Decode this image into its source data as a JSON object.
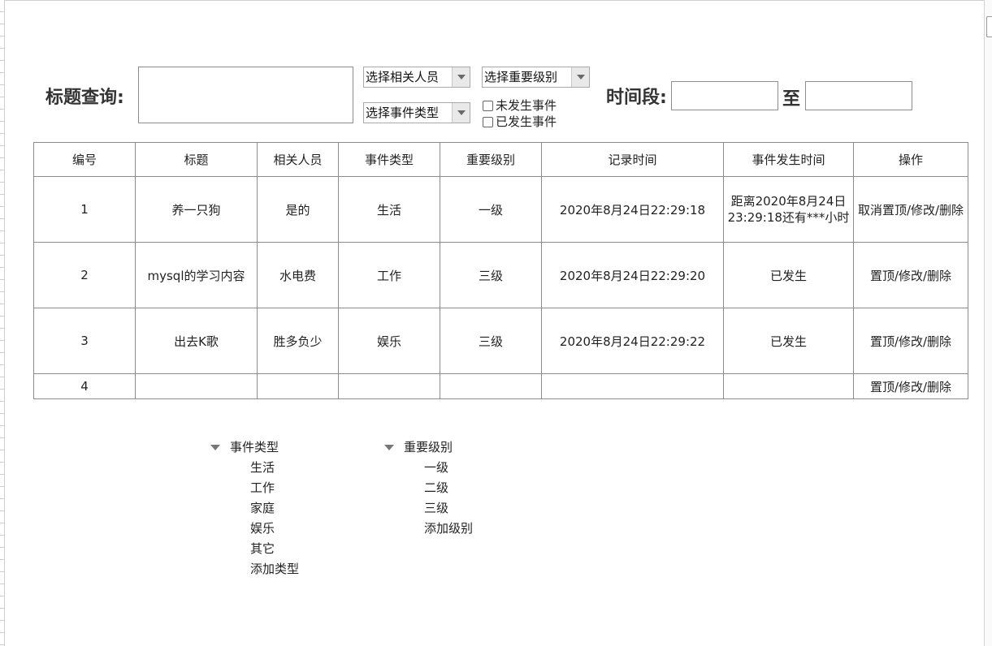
{
  "search": {
    "title_label": "标题查询:",
    "title_value": "",
    "person_select": "选择相关人员",
    "level_select": "选择重要级别",
    "type_select": "选择事件类型",
    "checkbox_not_happened": "未发生事件",
    "checkbox_happened": "已发生事件",
    "time_label": "时间段:",
    "to_label": "至",
    "time_start": "",
    "time_end": ""
  },
  "table": {
    "headers": [
      "编号",
      "标题",
      "相关人员",
      "事件类型",
      "重要级别",
      "记录时间",
      "事件发生时间",
      "操作"
    ],
    "rows": [
      {
        "id": "1",
        "title": "养一只狗",
        "person": "是的",
        "type": "生活",
        "level": "一级",
        "record_time": "2020年8月24日22:29:18",
        "event_time": "距离2020年8月24日23:29:18还有***小时",
        "action": "取消置顶/修改/删除"
      },
      {
        "id": "2",
        "title": "mysql的学习内容",
        "person": "水电费",
        "type": "工作",
        "level": "三级",
        "record_time": "2020年8月24日22:29:20",
        "event_time": "已发生",
        "action": "置顶/修改/删除"
      },
      {
        "id": "3",
        "title": "出去K歌",
        "person": "胜多负少",
        "type": "娱乐",
        "level": "三级",
        "record_time": "2020年8月24日22:29:22",
        "event_time": "已发生",
        "action": "置顶/修改/删除"
      },
      {
        "id": "4",
        "title": "",
        "person": "",
        "type": "",
        "level": "",
        "record_time": "",
        "event_time": "",
        "action": "置顶/修改/删除"
      }
    ]
  },
  "tree_type": {
    "label": "事件类型",
    "items": [
      "生活",
      "工作",
      "家庭",
      "娱乐",
      "其它",
      "添加类型"
    ]
  },
  "tree_level": {
    "label": "重要级别",
    "items": [
      "一级",
      "二级",
      "三级",
      "添加级别"
    ]
  },
  "colors": {
    "border": "#8c8c8c",
    "text": "#222222"
  }
}
